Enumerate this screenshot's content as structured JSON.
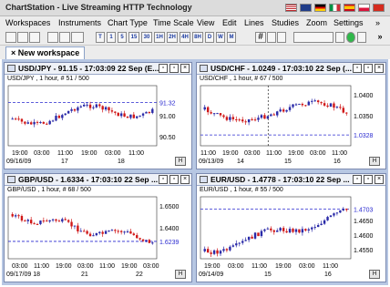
{
  "window": {
    "title": "ChartStation - Live Streaming HTTP Technology"
  },
  "menu": [
    "Workspaces",
    "Instruments",
    "Chart Type",
    "Time Scale",
    "View",
    "Edit",
    "Lines",
    "Studies",
    "Zoom",
    "Settings",
    "»"
  ],
  "toolbar": {
    "timeframes": [
      "T",
      "1",
      "5",
      "15",
      "30",
      "1H",
      "2H",
      "4H",
      "8H",
      "D",
      "W",
      "M"
    ]
  },
  "tabs": {
    "active_label": "New workspace",
    "close_glyph": "×"
  },
  "panels": [
    {
      "title": "USD/JPY - 91.15 - 17:03:09 22 Sep (E...",
      "subtitle": "USD/JPY , 1 hour, # 51 / 500",
      "y_labels": [
        "91.32",
        "91.00",
        "90.50"
      ],
      "x_labels": [
        "19:00",
        "03:00",
        "11:00",
        "19:00",
        "03:00",
        "11:00"
      ],
      "date_labels": [
        "09/16/09",
        "17",
        "18"
      ],
      "last_price": "91.32",
      "colors": {
        "up": "#2a2aa8",
        "down": "#d01818",
        "ref": "#2a2ad0"
      }
    },
    {
      "title": "USD/CHF - 1.0249 - 17:03:10 22 Sep (...",
      "subtitle": "USD/CHF , 1 hour, # 67 / 500",
      "y_labels": [
        "1.0400",
        "1.0350",
        "1.0328"
      ],
      "x_labels": [
        "11:00",
        "19:00",
        "03:00",
        "11:00",
        "19:00",
        "03:00",
        "11:00"
      ],
      "date_labels": [
        "09/13/09",
        "14",
        "15",
        "16"
      ],
      "last_price": "1.0328",
      "colors": {
        "up": "#2a2aa8",
        "down": "#d01818",
        "ref": "#2a2ad0"
      }
    },
    {
      "title": "GBP/USD - 1.6334 - 17:03:10 22 Sep ...",
      "subtitle": "GBP/USD , 1 hour, # 68 / 500",
      "y_labels": [
        "1.6500",
        "1.6400",
        "1.6239"
      ],
      "x_labels": [
        "03:00",
        "11:00",
        "19:00",
        "03:00",
        "11:00",
        "19:00",
        "03:00"
      ],
      "date_labels": [
        "09/17/09 18",
        "21",
        "22"
      ],
      "last_price": "1.6239",
      "colors": {
        "up": "#2a2aa8",
        "down": "#d01818",
        "ref": "#2a2ad0"
      }
    },
    {
      "title": "EUR/USD - 1.4778 - 17:03:10 22 Sep ...",
      "subtitle": "EUR/USD , 1 hour, # 55 / 500",
      "y_labels": [
        "1.4703",
        "1.4650",
        "1.4600",
        "1.4550"
      ],
      "x_labels": [
        "19:00",
        "03:00",
        "11:00",
        "19:00",
        "03:00",
        "11:00"
      ],
      "date_labels": [
        "09/14/09",
        "15",
        "16"
      ],
      "last_price": "1.4703",
      "colors": {
        "up": "#2a2aa8",
        "down": "#d01818",
        "ref": "#2a2ad0"
      }
    }
  ],
  "flag_colors": [
    "#c0282d",
    "#1f3c88",
    "#ffffff",
    "#009246",
    "#c8102e",
    "#ffffff",
    "#d52b1e"
  ]
}
